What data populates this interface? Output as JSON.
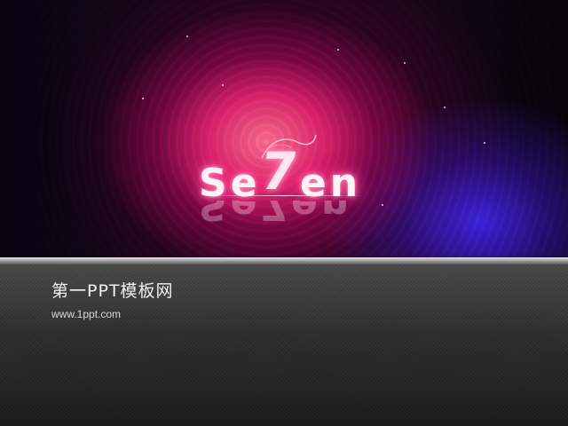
{
  "hero": {
    "logo_prefix": "Se",
    "logo_seven": "7",
    "logo_suffix": "en",
    "logo_reflection": "Se7en"
  },
  "footer": {
    "title": "第一PPT模板网",
    "url": "www.1ppt.com"
  },
  "colors": {
    "glow_pink": "#ff2a80",
    "glow_blue": "#4628ff",
    "panel_dark": "#2e2e2e",
    "divider": "#9a9a9a"
  }
}
